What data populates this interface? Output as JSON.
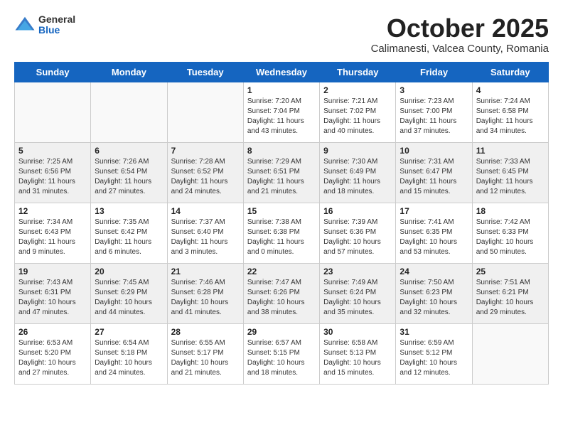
{
  "logo": {
    "general": "General",
    "blue": "Blue"
  },
  "title": "October 2025",
  "subtitle": "Calimanesti, Valcea County, Romania",
  "weekdays": [
    "Sunday",
    "Monday",
    "Tuesday",
    "Wednesday",
    "Thursday",
    "Friday",
    "Saturday"
  ],
  "weeks": [
    [
      {
        "day": "",
        "info": ""
      },
      {
        "day": "",
        "info": ""
      },
      {
        "day": "",
        "info": ""
      },
      {
        "day": "1",
        "info": "Sunrise: 7:20 AM\nSunset: 7:04 PM\nDaylight: 11 hours and 43 minutes."
      },
      {
        "day": "2",
        "info": "Sunrise: 7:21 AM\nSunset: 7:02 PM\nDaylight: 11 hours and 40 minutes."
      },
      {
        "day": "3",
        "info": "Sunrise: 7:23 AM\nSunset: 7:00 PM\nDaylight: 11 hours and 37 minutes."
      },
      {
        "day": "4",
        "info": "Sunrise: 7:24 AM\nSunset: 6:58 PM\nDaylight: 11 hours and 34 minutes."
      }
    ],
    [
      {
        "day": "5",
        "info": "Sunrise: 7:25 AM\nSunset: 6:56 PM\nDaylight: 11 hours and 31 minutes."
      },
      {
        "day": "6",
        "info": "Sunrise: 7:26 AM\nSunset: 6:54 PM\nDaylight: 11 hours and 27 minutes."
      },
      {
        "day": "7",
        "info": "Sunrise: 7:28 AM\nSunset: 6:52 PM\nDaylight: 11 hours and 24 minutes."
      },
      {
        "day": "8",
        "info": "Sunrise: 7:29 AM\nSunset: 6:51 PM\nDaylight: 11 hours and 21 minutes."
      },
      {
        "day": "9",
        "info": "Sunrise: 7:30 AM\nSunset: 6:49 PM\nDaylight: 11 hours and 18 minutes."
      },
      {
        "day": "10",
        "info": "Sunrise: 7:31 AM\nSunset: 6:47 PM\nDaylight: 11 hours and 15 minutes."
      },
      {
        "day": "11",
        "info": "Sunrise: 7:33 AM\nSunset: 6:45 PM\nDaylight: 11 hours and 12 minutes."
      }
    ],
    [
      {
        "day": "12",
        "info": "Sunrise: 7:34 AM\nSunset: 6:43 PM\nDaylight: 11 hours and 9 minutes."
      },
      {
        "day": "13",
        "info": "Sunrise: 7:35 AM\nSunset: 6:42 PM\nDaylight: 11 hours and 6 minutes."
      },
      {
        "day": "14",
        "info": "Sunrise: 7:37 AM\nSunset: 6:40 PM\nDaylight: 11 hours and 3 minutes."
      },
      {
        "day": "15",
        "info": "Sunrise: 7:38 AM\nSunset: 6:38 PM\nDaylight: 11 hours and 0 minutes."
      },
      {
        "day": "16",
        "info": "Sunrise: 7:39 AM\nSunset: 6:36 PM\nDaylight: 10 hours and 57 minutes."
      },
      {
        "day": "17",
        "info": "Sunrise: 7:41 AM\nSunset: 6:35 PM\nDaylight: 10 hours and 53 minutes."
      },
      {
        "day": "18",
        "info": "Sunrise: 7:42 AM\nSunset: 6:33 PM\nDaylight: 10 hours and 50 minutes."
      }
    ],
    [
      {
        "day": "19",
        "info": "Sunrise: 7:43 AM\nSunset: 6:31 PM\nDaylight: 10 hours and 47 minutes."
      },
      {
        "day": "20",
        "info": "Sunrise: 7:45 AM\nSunset: 6:29 PM\nDaylight: 10 hours and 44 minutes."
      },
      {
        "day": "21",
        "info": "Sunrise: 7:46 AM\nSunset: 6:28 PM\nDaylight: 10 hours and 41 minutes."
      },
      {
        "day": "22",
        "info": "Sunrise: 7:47 AM\nSunset: 6:26 PM\nDaylight: 10 hours and 38 minutes."
      },
      {
        "day": "23",
        "info": "Sunrise: 7:49 AM\nSunset: 6:24 PM\nDaylight: 10 hours and 35 minutes."
      },
      {
        "day": "24",
        "info": "Sunrise: 7:50 AM\nSunset: 6:23 PM\nDaylight: 10 hours and 32 minutes."
      },
      {
        "day": "25",
        "info": "Sunrise: 7:51 AM\nSunset: 6:21 PM\nDaylight: 10 hours and 29 minutes."
      }
    ],
    [
      {
        "day": "26",
        "info": "Sunrise: 6:53 AM\nSunset: 5:20 PM\nDaylight: 10 hours and 27 minutes."
      },
      {
        "day": "27",
        "info": "Sunrise: 6:54 AM\nSunset: 5:18 PM\nDaylight: 10 hours and 24 minutes."
      },
      {
        "day": "28",
        "info": "Sunrise: 6:55 AM\nSunset: 5:17 PM\nDaylight: 10 hours and 21 minutes."
      },
      {
        "day": "29",
        "info": "Sunrise: 6:57 AM\nSunset: 5:15 PM\nDaylight: 10 hours and 18 minutes."
      },
      {
        "day": "30",
        "info": "Sunrise: 6:58 AM\nSunset: 5:13 PM\nDaylight: 10 hours and 15 minutes."
      },
      {
        "day": "31",
        "info": "Sunrise: 6:59 AM\nSunset: 5:12 PM\nDaylight: 10 hours and 12 minutes."
      },
      {
        "day": "",
        "info": ""
      }
    ]
  ]
}
